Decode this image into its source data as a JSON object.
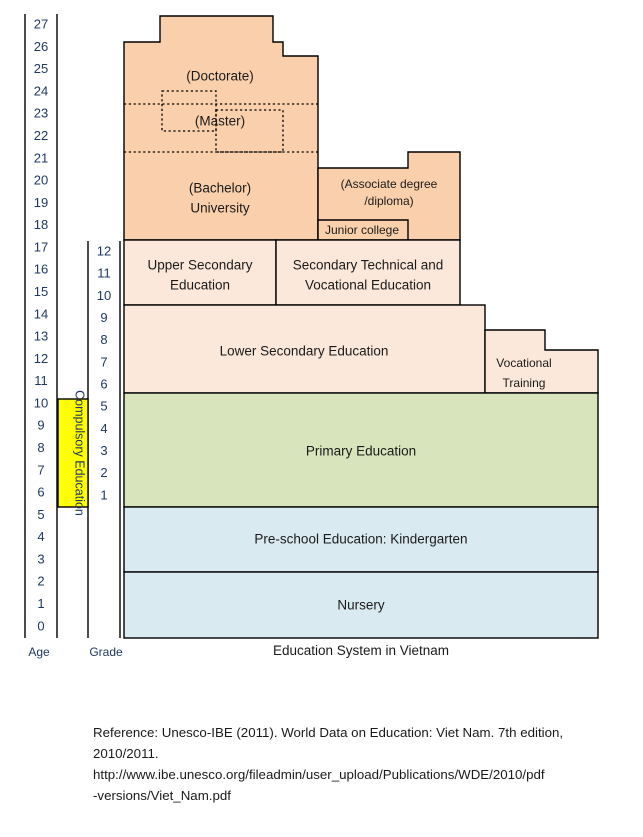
{
  "figure": {
    "caption": "Education System in Vietnam",
    "axes": {
      "age": {
        "title": "Age",
        "ticks": [
          27,
          26,
          25,
          24,
          23,
          22,
          21,
          20,
          19,
          18,
          17,
          16,
          15,
          14,
          13,
          12,
          11,
          10,
          9,
          8,
          7,
          6,
          5,
          4,
          3,
          2,
          1,
          0
        ]
      },
      "grade": {
        "title": "Grade",
        "ticks": [
          12,
          11,
          10,
          9,
          8,
          7,
          6,
          5,
          4,
          3,
          2,
          1
        ]
      }
    },
    "compulsory": {
      "label": "Compulsory Education",
      "color": "#FFFF00",
      "age_from": 6,
      "age_to": 10,
      "grade_from": 1,
      "grade_to": 5
    },
    "levels": [
      {
        "name": "doctorate",
        "label": "(Doctorate)",
        "color": "#FAD0AC",
        "age_from": 23,
        "age_to": 27
      },
      {
        "name": "master",
        "label": "(Master)",
        "color": "#FAD0AC",
        "age_from": 22,
        "age_to": 24
      },
      {
        "name": "university-bachelor",
        "label_line1": "(Bachelor)",
        "label_line2": "University",
        "color": "#FAD0AC",
        "age_from": 18,
        "age_to": 22
      },
      {
        "name": "associate-degree",
        "label_line1": "(Associate degree",
        "label_line2": "/diploma)",
        "color": "#FAD0AC",
        "age_from": 18,
        "age_to": 21
      },
      {
        "name": "junior-college",
        "label": "Junior college",
        "color": "#FAD0AC",
        "age_from": 18,
        "age_to": 19
      },
      {
        "name": "upper-secondary",
        "label_line1": "Upper Secondary",
        "label_line2": "Education",
        "color": "#FCE8DA",
        "age_from": 15,
        "age_to": 18,
        "grade_from": 10,
        "grade_to": 12
      },
      {
        "name": "secondary-technical-vocational",
        "label_line1": "Secondary Technical and",
        "label_line2": "Vocational Education",
        "color": "#FCE8DA",
        "age_from": 15,
        "age_to": 18,
        "grade_from": 10,
        "grade_to": 12
      },
      {
        "name": "lower-secondary",
        "label": "Lower Secondary Education",
        "color": "#FCE8DA",
        "age_from": 11,
        "age_to": 15,
        "grade_from": 6,
        "grade_to": 9
      },
      {
        "name": "vocational-training",
        "label_line1": "Vocational",
        "label_line2": "Training",
        "color": "#FCE8DA",
        "age_from": 11,
        "age_to": 14
      },
      {
        "name": "primary-education",
        "label": "Primary Education",
        "color": "#D7E4BC",
        "age_from": 6,
        "age_to": 11,
        "grade_from": 1,
        "grade_to": 5
      },
      {
        "name": "pre-school-kindergarten",
        "label": "Pre-school Education: Kindergarten",
        "color": "#DAEAF1",
        "age_from": 3,
        "age_to": 6
      },
      {
        "name": "nursery",
        "label": "Nursery",
        "color": "#DAEAF1",
        "age_from": 0,
        "age_to": 3
      }
    ],
    "reference": {
      "line1": "Reference: Unesco-IBE (2011). World Data on Education: Viet Nam. 7th edition,",
      "line2": "2010/2011.",
      "line3": "http://www.ibe.unesco.org/fileadmin/user_upload/Publications/WDE/2010/pdf",
      "line4": "-versions/Viet_Nam.pdf"
    }
  }
}
